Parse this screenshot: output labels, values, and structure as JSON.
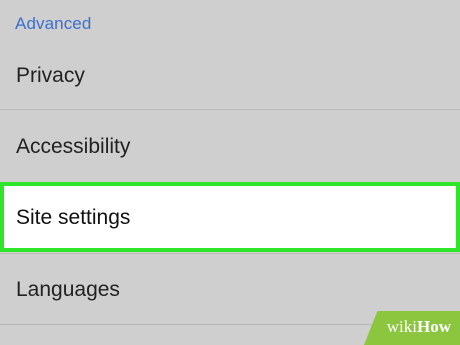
{
  "section": {
    "header": "Advanced"
  },
  "items": [
    {
      "label": "Privacy"
    },
    {
      "label": "Accessibility"
    },
    {
      "label": "Site settings",
      "highlighted": true
    },
    {
      "label": "Languages"
    }
  ],
  "highlight_color": "#2ee52a",
  "accent_color": "#3b6fd0",
  "watermark": {
    "part1": "wiki",
    "part2": "How"
  }
}
